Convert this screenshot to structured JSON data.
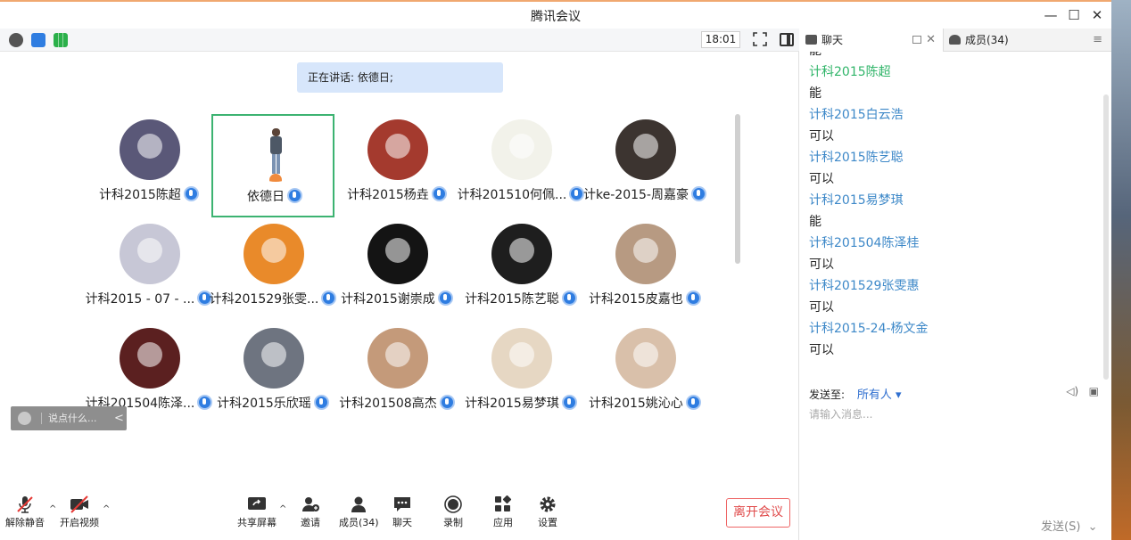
{
  "window": {
    "title": "腾讯会议",
    "controls": [
      "—",
      "☐",
      "✕"
    ]
  },
  "topbar": {
    "time": "18:01",
    "icons": [
      "info-icon",
      "shield-icon",
      "signal-icon",
      "fullscreen-icon",
      "layout-icon"
    ]
  },
  "speaker": {
    "text": "正在讲话: 依德日;"
  },
  "participants": [
    {
      "name": "计科2015陈超",
      "color": "#5a5878"
    },
    {
      "name": "依德日",
      "color": "#ffffff"
    },
    {
      "name": "计科2015杨垚",
      "color": "#a43a2e"
    },
    {
      "name": "计科201510何佩...",
      "color": "#f2f2ea"
    },
    {
      "name": "计ke-2015-周嘉豪",
      "color": "#3c3430"
    },
    {
      "name": "计科2015 - 07 - ...",
      "color": "#c7c7d6"
    },
    {
      "name": "计科201529张雯...",
      "color": "#e98a2a"
    },
    {
      "name": "计科2015谢崇成",
      "color": "#141414"
    },
    {
      "name": "计科2015陈艺聪",
      "color": "#1e1e1e"
    },
    {
      "name": "计科2015皮嘉也",
      "color": "#b79a82"
    },
    {
      "name": "计科201504陈泽...",
      "color": "#5b2020"
    },
    {
      "name": "计科2015乐欣瑶",
      "color": "#6e7480"
    },
    {
      "name": "计科201508高杰",
      "color": "#c49a7a"
    },
    {
      "name": "计科2015易梦琪",
      "color": "#e6d7c3"
    },
    {
      "name": "计科2015姚沁心",
      "color": "#d9c0aa"
    }
  ],
  "float_chat": {
    "placeholder": "说点什么...",
    "arrow": "<"
  },
  "toolbar": {
    "mute": "解除静音",
    "video": "开启视频",
    "share": "共享屏幕",
    "invite": "邀请",
    "members": "成员(34)",
    "chat": "聊天",
    "record": "录制",
    "apps": "应用",
    "settings": "设置",
    "leave": "离开会议"
  },
  "panel": {
    "chat_tab": "聊天",
    "members_tab": "成员(34)",
    "messages": [
      {
        "sender": "",
        "text": "能"
      },
      {
        "sender": "计科2015陈超",
        "text": "能"
      },
      {
        "sender": "计科2015白云浩",
        "text": "可以"
      },
      {
        "sender": "计科2015陈艺聪",
        "text": "可以"
      },
      {
        "sender": "计科2015易梦琪",
        "text": "能"
      },
      {
        "sender": "计科201504陈泽桂",
        "text": "可以"
      },
      {
        "sender": "计科201529张雯惠",
        "text": "可以"
      },
      {
        "sender": "计科2015-24-杨文金",
        "text": "可以"
      }
    ],
    "send_to_label": "发送至:",
    "send_to_value": "所有人",
    "input_placeholder": "请输入消息...",
    "send_button": "发送(S)"
  }
}
